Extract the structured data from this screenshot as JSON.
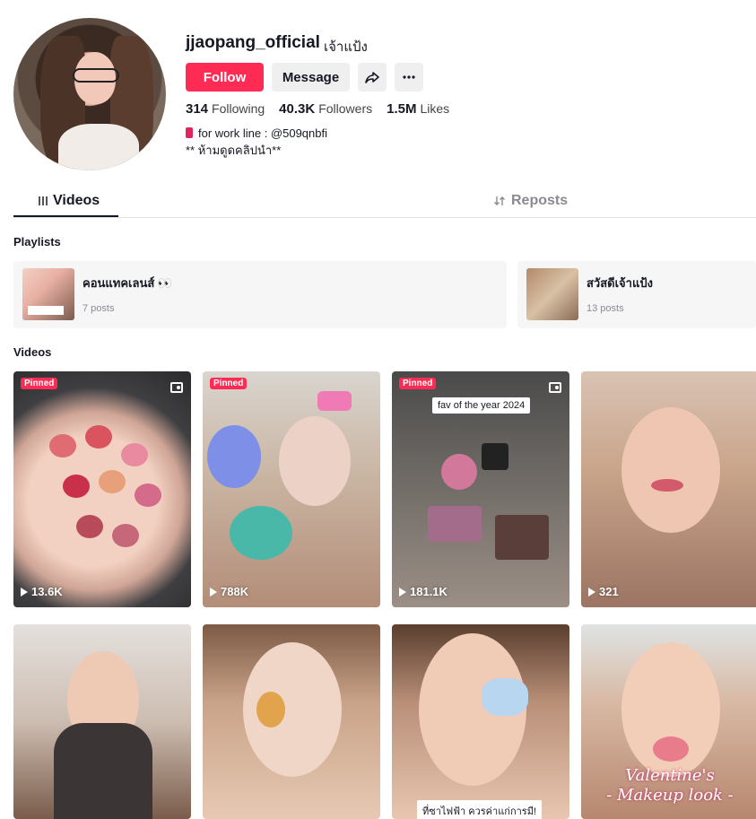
{
  "profile": {
    "username": "jjaopang_official",
    "nickname": "เจ้าแป้ง",
    "follow_label": "Follow",
    "message_label": "Message",
    "stats": [
      {
        "value": "314",
        "label": "Following"
      },
      {
        "value": "40.3K",
        "label": "Followers"
      },
      {
        "value": "1.5M",
        "label": "Likes"
      }
    ],
    "bio_line1": "for work line : @509qnbfi",
    "bio_line2": "** ห้ามดูดคลิปนำ**"
  },
  "tabs": {
    "videos": "Videos",
    "reposts": "Reposts"
  },
  "sections": {
    "playlists": "Playlists",
    "videos": "Videos"
  },
  "playlists": [
    {
      "title": "คอนแทคเลนส์ 👀",
      "count": "7 posts"
    },
    {
      "title": "สวัสดีเจ้าแป้ง",
      "count": "13 posts"
    }
  ],
  "videos": [
    {
      "pinned": "Pinned",
      "views": "13.6K"
    },
    {
      "pinned": "Pinned",
      "views": "788K"
    },
    {
      "pinned": "Pinned",
      "views": "181.1K",
      "overlay": "fav of the year 2024"
    },
    {
      "views": "321"
    },
    {},
    {},
    {
      "caption": "ที่ซาไฟฟ้า ควรค่าแก่การมี!"
    },
    {
      "title_line1": "Valentine's",
      "title_line2": "- Makeup look -"
    }
  ],
  "colors": {
    "accent": "#fe2c55",
    "text": "#161823",
    "muted": "#8a8b91"
  }
}
